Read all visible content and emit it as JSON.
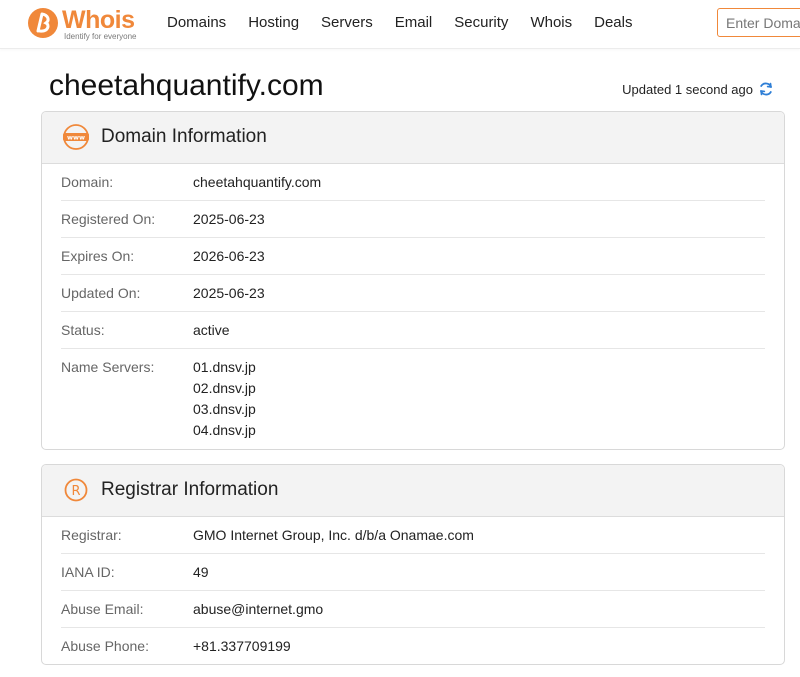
{
  "brand": {
    "name_prefix": "Who",
    "name_suffix": "is",
    "tagline": "Identify for everyone",
    "color": "#f0883a"
  },
  "nav": [
    {
      "label": "Domains"
    },
    {
      "label": "Hosting"
    },
    {
      "label": "Servers"
    },
    {
      "label": "Email"
    },
    {
      "label": "Security"
    },
    {
      "label": "Whois"
    },
    {
      "label": "Deals"
    }
  ],
  "search": {
    "placeholder": "Enter Domain",
    "value": ""
  },
  "page": {
    "domain": "cheetahquantify.com",
    "updated": "Updated 1 second ago"
  },
  "domain_info": {
    "title": "Domain Information",
    "icon": "www-icon",
    "rows": [
      {
        "label": "Domain:",
        "value": "cheetahquantify.com"
      },
      {
        "label": "Registered On:",
        "value": "2025-06-23"
      },
      {
        "label": "Expires On:",
        "value": "2026-06-23"
      },
      {
        "label": "Updated On:",
        "value": "2025-06-23"
      },
      {
        "label": "Status:",
        "value": "active"
      }
    ],
    "name_servers": {
      "label": "Name Servers:",
      "values": [
        "01.dnsv.jp",
        "02.dnsv.jp",
        "03.dnsv.jp",
        "04.dnsv.jp"
      ]
    }
  },
  "registrar_info": {
    "title": "Registrar Information",
    "icon": "registered-icon",
    "rows": [
      {
        "label": "Registrar:",
        "value": "GMO Internet Group, Inc. d/b/a Onamae.com"
      },
      {
        "label": "IANA ID:",
        "value": "49"
      },
      {
        "label": "Abuse Email:",
        "value": "abuse@internet.gmo"
      },
      {
        "label": "Abuse Phone:",
        "value": "+81.337709199"
      }
    ]
  }
}
